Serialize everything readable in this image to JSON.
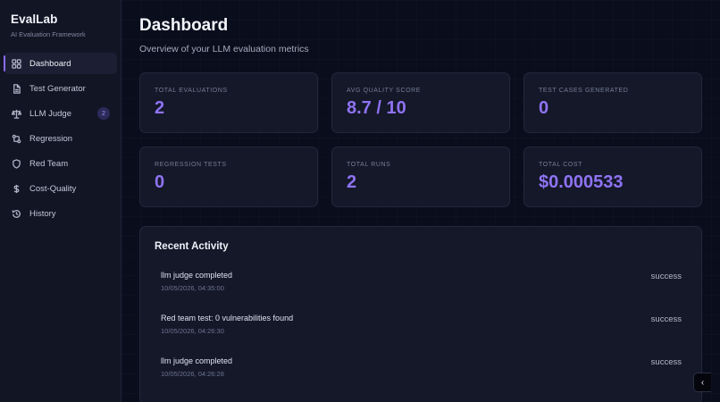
{
  "app": {
    "title": "EvalLab",
    "subtitle": "AI Evaluation Framework"
  },
  "sidebar": {
    "items": [
      {
        "label": "Dashboard",
        "icon": "dashboard-grid-icon",
        "active": true
      },
      {
        "label": "Test Generator",
        "icon": "document-icon"
      },
      {
        "label": "LLM Judge",
        "icon": "scale-icon",
        "badge": "2"
      },
      {
        "label": "Regression",
        "icon": "git-compare-icon"
      },
      {
        "label": "Red Team",
        "icon": "shield-icon"
      },
      {
        "label": "Cost-Quality",
        "icon": "dollar-icon"
      },
      {
        "label": "History",
        "icon": "history-icon"
      }
    ]
  },
  "header": {
    "title": "Dashboard",
    "subtitle": "Overview of your LLM evaluation metrics"
  },
  "stats": [
    {
      "label": "TOTAL EVALUATIONS",
      "value": "2"
    },
    {
      "label": "AVG QUALITY SCORE",
      "value": "8.7 / 10"
    },
    {
      "label": "TEST CASES GENERATED",
      "value": "0"
    },
    {
      "label": "REGRESSION TESTS",
      "value": "0"
    },
    {
      "label": "TOTAL RUNS",
      "value": "2"
    },
    {
      "label": "TOTAL COST",
      "value": "$0.000533"
    }
  ],
  "activity": {
    "title": "Recent Activity",
    "items": [
      {
        "text": "llm judge completed",
        "time": "10/05/2026, 04:35:00",
        "status": "success"
      },
      {
        "text": "Red team test: 0 vulnerabilities found",
        "time": "10/05/2026, 04:26:30",
        "status": "success"
      },
      {
        "text": "llm judge completed",
        "time": "10/05/2026, 04:26:28",
        "status": "success"
      }
    ]
  },
  "colors": {
    "accent": "#8f73f3",
    "background": "#0a0d1b",
    "sidebar": "#121524",
    "card": "#141829"
  }
}
